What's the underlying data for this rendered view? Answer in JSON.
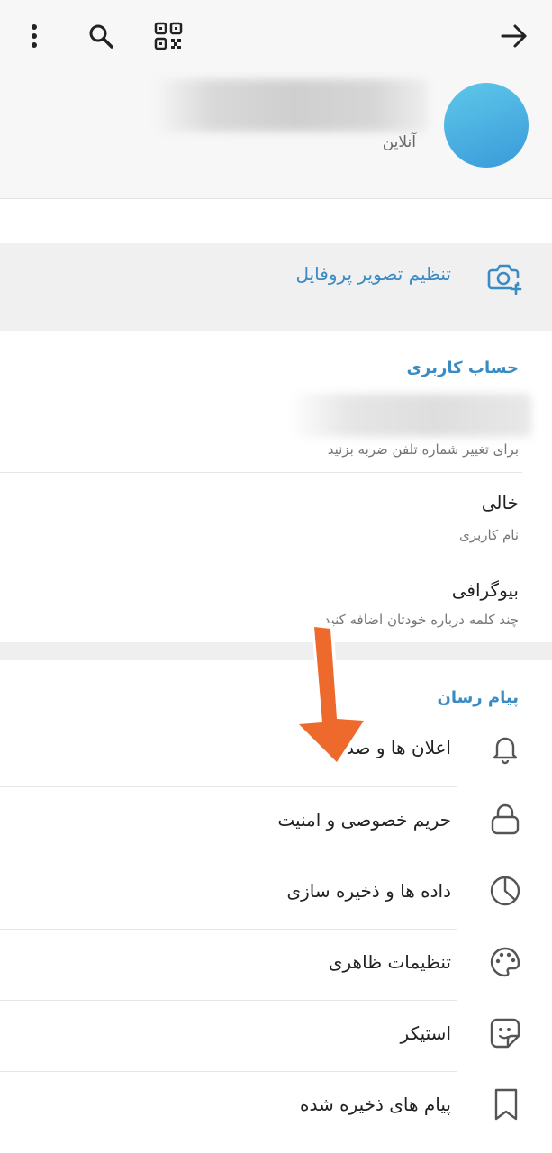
{
  "header": {
    "status": "آنلاین",
    "icons": {
      "back": "arrow-right-icon",
      "qr": "qr-code-icon",
      "search": "search-icon",
      "more": "more-vertical-icon"
    }
  },
  "profile_photo": {
    "label": "تنظیم تصویر پروفایل",
    "icon": "camera-add-icon"
  },
  "account": {
    "title": "حساب کاربری",
    "phone_hint": "برای تغییر شماره تلفن ضربه بزنید",
    "username_value": "خالی",
    "username_label": "نام کاربری",
    "bio_title": "بیوگرافی",
    "bio_hint": "چند کلمه درباره خودتان اضافه کنید"
  },
  "messenger": {
    "title": "پیام رسان",
    "items": [
      {
        "label": "اعلان ها و صداها",
        "icon": "bell-icon"
      },
      {
        "label": "حریم خصوصی و امنیت",
        "icon": "lock-icon"
      },
      {
        "label": "داده ها و ذخیره سازی",
        "icon": "pie-chart-icon"
      },
      {
        "label": "تنظیمات ظاهری",
        "icon": "palette-icon"
      },
      {
        "label": "استیکر",
        "icon": "sticker-icon"
      },
      {
        "label": "پیام های ذخیره شده",
        "icon": "bookmark-icon"
      }
    ]
  },
  "colors": {
    "accent": "#3a8bc4",
    "arrow": "#ee6a2c",
    "avatar_top": "#5ec8ea",
    "avatar_bottom": "#3a9ad9"
  }
}
